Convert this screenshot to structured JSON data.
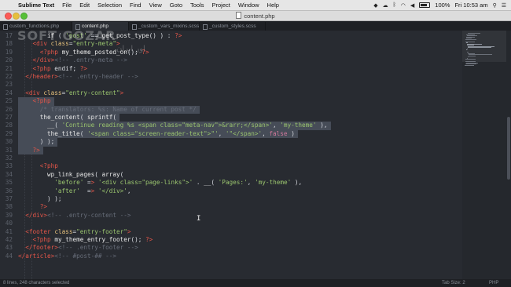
{
  "menubar": {
    "apple_icon": "apple-icon",
    "app_name": "Sublime Text",
    "items": [
      "File",
      "Edit",
      "Selection",
      "Find",
      "View",
      "Goto",
      "Tools",
      "Project",
      "Window",
      "Help"
    ],
    "battery": "100%",
    "clock": "Fri 10:53 am"
  },
  "window": {
    "title": "content.php"
  },
  "tabs": [
    {
      "label": "custom_functions.php",
      "active": false
    },
    {
      "label": "content.php",
      "active": true
    },
    {
      "label": "_custom_vars_mixins.scss",
      "active": false
    },
    {
      "label": "_custom_styles.scss",
      "active": false
    }
  ],
  "watermark": {
    "text": "SOFT GOZAR",
    "sub": "اور ایران"
  },
  "editor": {
    "lines": [
      {
        "n": "17",
        "text": "        if ( 'post' == get_post_type() ) : ?>"
      },
      {
        "n": "18",
        "text": "    <div class=\"entry-meta\">"
      },
      {
        "n": "19",
        "text": "      <?php my_theme_posted_on(); ?>"
      },
      {
        "n": "20",
        "text": "    </div><!-- .entry-meta -->"
      },
      {
        "n": "21",
        "text": "    <?php endif; ?>"
      },
      {
        "n": "22",
        "text": "  </header><!-- .entry-header -->"
      },
      {
        "n": "23",
        "text": ""
      },
      {
        "n": "24",
        "text": "  <div class=\"entry-content\">"
      },
      {
        "n": "25",
        "text": "    <?php"
      },
      {
        "n": "26",
        "text": "      /* translators: %s: Name of current post */"
      },
      {
        "n": "27",
        "text": "      the_content( sprintf("
      },
      {
        "n": "28",
        "text": "        __( 'Continue reading %s <span class=\"meta-nav\">&rarr;</span>', 'my-theme' ),"
      },
      {
        "n": "29",
        "text": "        the_title( '<span class=\"screen-reader-text\">\"', '\"</span>', false )"
      },
      {
        "n": "30",
        "text": "      ) );"
      },
      {
        "n": "31",
        "text": "    ?>"
      },
      {
        "n": "32",
        "text": ""
      },
      {
        "n": "33",
        "text": "      <?php"
      },
      {
        "n": "34",
        "text": "        wp_link_pages( array("
      },
      {
        "n": "35",
        "text": "          'before' => '<div class=\"page-links\">' . __( 'Pages:', 'my-theme' ),"
      },
      {
        "n": "36",
        "text": "          'after'  => '</div>',"
      },
      {
        "n": "37",
        "text": "        ) );"
      },
      {
        "n": "38",
        "text": "      ?>"
      },
      {
        "n": "39",
        "text": "  </div><!-- .entry-content -->"
      },
      {
        "n": "40",
        "text": ""
      },
      {
        "n": "41",
        "text": "  <footer class=\"entry-footer\">"
      },
      {
        "n": "42",
        "text": "    <?php my_theme_entry_footer(); ?>"
      },
      {
        "n": "43",
        "text": "  </footer><!-- .entry-footer -->"
      },
      {
        "n": "44",
        "text": "</article><!-- #post-## -->"
      }
    ],
    "selected_lines": [
      "25",
      "26",
      "27",
      "28",
      "29",
      "30",
      "31"
    ]
  },
  "statusbar": {
    "left": "8 lines, 248 characters selected",
    "tab_size": "Tab Size: 2",
    "syntax": "PHP"
  },
  "colors": {
    "background": "#282b31",
    "selection": "#464c57",
    "tag": "#e45649",
    "string": "#9ac46e",
    "attribute": "#e5c07b",
    "comment": "#666c78"
  }
}
